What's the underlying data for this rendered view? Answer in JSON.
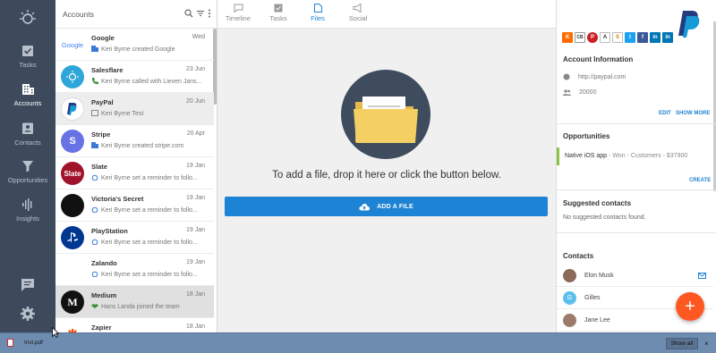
{
  "nav": {
    "items": [
      {
        "label": "Tasks"
      },
      {
        "label": "Accounts"
      },
      {
        "label": "Contacts"
      },
      {
        "label": "Opportunities"
      },
      {
        "label": "Insights"
      }
    ]
  },
  "list": {
    "title": "Accounts",
    "accounts": [
      {
        "name": "Google",
        "date": "Wed",
        "activity": "Keri Byrne created Google"
      },
      {
        "name": "Salesflare",
        "date": "23 Jun",
        "activity": "Keri Byrne called with Lieven Jans..."
      },
      {
        "name": "PayPal",
        "date": "20 Jun",
        "activity": "Keri Byrne Test"
      },
      {
        "name": "Stripe",
        "date": "20 Apr",
        "activity": "Keri Byrne created stripe.com"
      },
      {
        "name": "Slate",
        "date": "19 Jan",
        "activity": "Keri Byrne set a reminder to follo..."
      },
      {
        "name": "Victoria's Secret",
        "date": "19 Jan",
        "activity": "Keri Byrne set a reminder to follo..."
      },
      {
        "name": "PlayStation",
        "date": "19 Jan",
        "activity": "Keri Byrne set a reminder to follo..."
      },
      {
        "name": "Zalando",
        "date": "19 Jan",
        "activity": "Keri Byrne set a reminder to follo..."
      },
      {
        "name": "Medium",
        "date": "18 Jan",
        "activity": "Hans Landa joined the team"
      },
      {
        "name": "Zapier",
        "date": "18 Jan",
        "activity": ""
      }
    ],
    "avatar_texts": {
      "google": "Google",
      "slate": "Slate",
      "stripe": "S",
      "medium": "M"
    }
  },
  "tabs": [
    {
      "label": "Timeline"
    },
    {
      "label": "Tasks"
    },
    {
      "label": "Files"
    },
    {
      "label": "Social"
    }
  ],
  "files": {
    "drop_text": "To add a file, drop it here or click the button below.",
    "add_button": "ADD A FILE"
  },
  "right": {
    "social_glyphs": [
      "K",
      "CB",
      "P",
      "A",
      "S",
      "t",
      "f",
      "in",
      "in"
    ],
    "account_info_title": "Account Information",
    "website": "http://paypal.com",
    "employees": "20000",
    "edit": "EDIT",
    "show_more": "SHOW MORE",
    "opportunities_title": "Opportunities",
    "opportunity": {
      "name": "Native iOS app",
      "status": "- Won",
      "pipeline": "- Customers",
      "value": "- $37900"
    },
    "create": "CREATE",
    "suggested_title": "Suggested contacts",
    "suggested_empty": "No suggested contacts found.",
    "contacts_title": "Contacts",
    "contacts": [
      {
        "name": "Elon Musk",
        "initial": ""
      },
      {
        "name": "Gilles",
        "initial": "G"
      },
      {
        "name": "Jane Lee",
        "initial": ""
      }
    ],
    "fab": "+"
  },
  "downloads": {
    "file": "Invi.pdf",
    "show_all": "Show all",
    "close": "×"
  },
  "colors": {
    "accent": "#1d83d4",
    "nav_bg": "#3c4a5c",
    "fab": "#ff5722",
    "won": "#8bc34a"
  }
}
